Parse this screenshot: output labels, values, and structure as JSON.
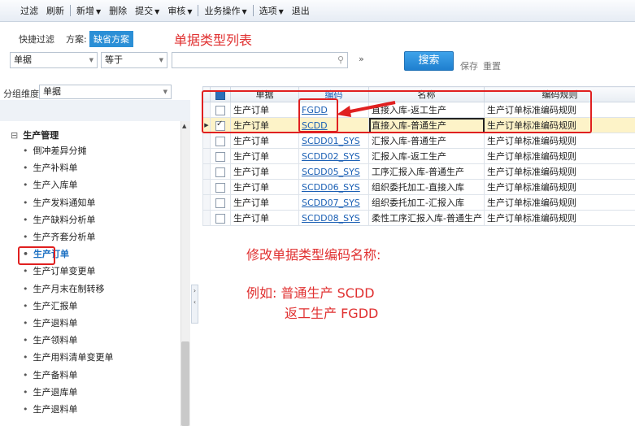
{
  "toolbar": {
    "filter": "过滤",
    "refresh": "刷新",
    "new": "新增",
    "delete": "删除",
    "submit": "提交",
    "audit": "审核",
    "business": "业务操作",
    "options": "选项",
    "exit": "退出"
  },
  "filter": {
    "quick_filter": "快捷过滤",
    "scheme_label": "方案:",
    "scheme_value": "缺省方案",
    "annotation_title": "单据类型列表",
    "field_value": "单据",
    "operator_value": "等于",
    "search_value": "",
    "search_button": "搜索",
    "save": "保存",
    "reset": "重置"
  },
  "left": {
    "group_label": "分组维度",
    "group_value": "单据",
    "root": "生产管理",
    "items": [
      "倒冲差异分摊",
      "生产补料单",
      "生产入库单",
      "生产发料通知单",
      "生产缺料分析单",
      "生产齐套分析单",
      "生产订单",
      "生产订单变更单",
      "生产月末在制转移",
      "生产汇报单",
      "生产退料单",
      "生产领料单",
      "生产用料清单变更单",
      "生产备料单",
      "生产退库单",
      "生产退料单"
    ],
    "selected_index": 6
  },
  "grid": {
    "headers": [
      "单据",
      "编码",
      "名称",
      "编码规则"
    ],
    "rows": [
      {
        "doc": "生产订单",
        "code": "FGDD",
        "name": "直接入库-返工生产",
        "rule": "生产订单标准编码规则",
        "checked": false
      },
      {
        "doc": "生产订单",
        "code": "SCDD",
        "name": "直接入库-普通生产",
        "rule": "生产订单标准编码规则",
        "checked": true
      },
      {
        "doc": "生产订单",
        "code": "SCDD01_SYS",
        "name": "汇报入库-普通生产",
        "rule": "生产订单标准编码规则",
        "checked": false
      },
      {
        "doc": "生产订单",
        "code": "SCDD02_SYS",
        "name": "汇报入库-返工生产",
        "rule": "生产订单标准编码规则",
        "checked": false
      },
      {
        "doc": "生产订单",
        "code": "SCDD05_SYS",
        "name": "工序汇报入库-普通生产",
        "rule": "生产订单标准编码规则",
        "checked": false
      },
      {
        "doc": "生产订单",
        "code": "SCDD06_SYS",
        "name": "组织委托加工-直接入库",
        "rule": "生产订单标准编码规则",
        "checked": false
      },
      {
        "doc": "生产订单",
        "code": "SCDD07_SYS",
        "name": "组织委托加工-汇报入库",
        "rule": "生产订单标准编码规则",
        "checked": false
      },
      {
        "doc": "生产订单",
        "code": "SCDD08_SYS",
        "name": "柔性工序汇报入库-普通生产",
        "rule": "生产订单标准编码规则",
        "checked": false
      }
    ]
  },
  "annotations": {
    "modify": "修改单据类型编码名称:",
    "example1": "例如: 普通生产 SCDD",
    "example2": "返工生产 FGDD"
  },
  "colors": {
    "accent": "#2b8fd6",
    "annotation": "#e03030",
    "selected_row": "#fdf3c8"
  }
}
